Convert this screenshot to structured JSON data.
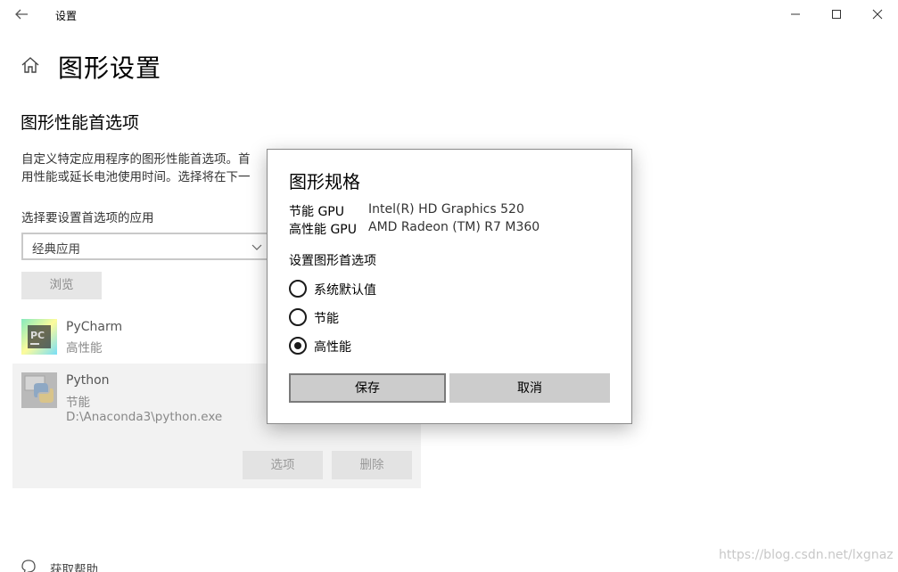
{
  "window": {
    "title": "设置"
  },
  "page": {
    "title": "图形设置",
    "section_title": "图形性能首选项",
    "description_line1": "自定义特定应用程序的图形性能首选项。首",
    "description_line2": "用性能或延长电池使用时间。选择将在下一",
    "app_select_label": "选择要设置首选项的应用",
    "dropdown_value": "经典应用",
    "browse_label": "浏览"
  },
  "apps": [
    {
      "name": "PyCharm",
      "preference": "高性能"
    },
    {
      "name": "Python",
      "preference": "节能",
      "path": "D:\\Anaconda3\\python.exe"
    }
  ],
  "app_actions": {
    "options_label": "选项",
    "delete_label": "删除"
  },
  "help": {
    "label": "获取帮助"
  },
  "watermark": "https://blog.csdn.net/lxgnaz",
  "dialog": {
    "title": "图形规格",
    "power_saving_gpu_label": "节能 GPU",
    "power_saving_gpu_value": "Intel(R) HD Graphics 520",
    "high_perf_gpu_label": "高性能 GPU",
    "high_perf_gpu_value": "AMD Radeon (TM) R7 M360",
    "preference_label": "设置图形首选项",
    "options": [
      {
        "label": "系统默认值",
        "selected": false
      },
      {
        "label": "节能",
        "selected": false
      },
      {
        "label": "高性能",
        "selected": true
      }
    ],
    "save_label": "保存",
    "cancel_label": "取消"
  },
  "colors": {
    "accent": "#000000",
    "button_gray": "#cccccc",
    "selected_item_bg": "#f2f2f2"
  }
}
